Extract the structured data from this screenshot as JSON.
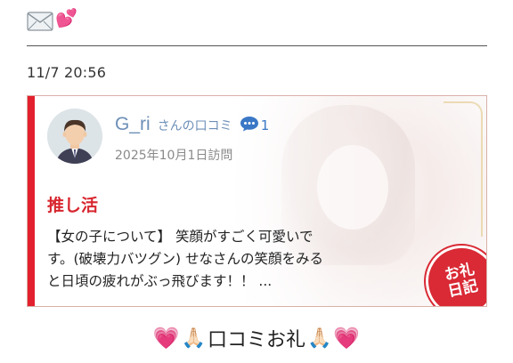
{
  "header": {
    "icons": [
      "envelope-icon",
      "two-hearts-icon"
    ],
    "hearts": "💕",
    "timestamp": "11/7 20:56"
  },
  "review_card": {
    "reviewer_name": "G_ri",
    "reviewer_suffix": "さんの口コミ",
    "comment_count": "1",
    "visit_date": "2025年10月1日訪問",
    "headline": "推し活",
    "body_lines": [
      "【女の子について】 笑顔がすごく可愛いで",
      "す。(破壊力バツグン) せなさんの笑顔をみる",
      "と日頃の疲れがぶっ飛びます！！ ..."
    ],
    "stamp_lines": [
      "お礼",
      "日記"
    ],
    "colors": {
      "accent": "#e3202d",
      "name": "#6d8fb8",
      "stamp": "#d92a35"
    }
  },
  "footer": {
    "heart_left": "💗",
    "emoji_left": "🙏🏻",
    "title": "口コミお礼",
    "emoji_right": "🙏🏻",
    "heart_right": "💗"
  }
}
